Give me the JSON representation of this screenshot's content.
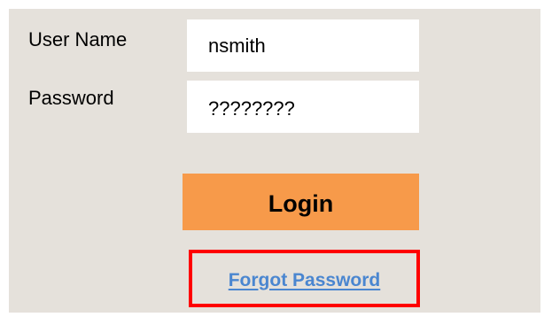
{
  "login_form": {
    "username_label": "User Name",
    "username_value": "nsmith",
    "password_label": "Password",
    "password_value": "????????",
    "login_button_label": "Login",
    "forgot_password_link": "Forgot Password"
  },
  "colors": {
    "panel_background": "#e5e1db",
    "login_button": "#f79a4a",
    "link": "#4a86d0",
    "highlight_border": "#ff0000"
  }
}
